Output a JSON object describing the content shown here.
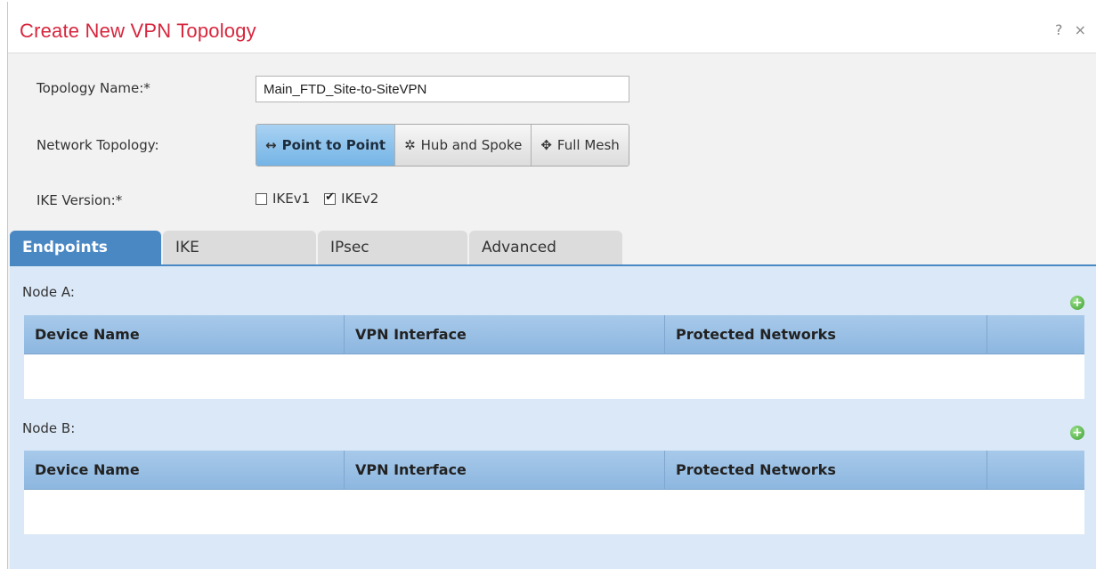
{
  "dialog": {
    "title": "Create New VPN Topology",
    "help": "?",
    "close": "×"
  },
  "form": {
    "topology_name_label": "Topology Name:*",
    "topology_name_value": "Main_FTD_Site-to-SiteVPN",
    "network_topology_label": "Network Topology:",
    "topology_options": [
      {
        "label": "Point to Point",
        "icon": "↔",
        "selected": true
      },
      {
        "label": "Hub and Spoke",
        "icon": "✲",
        "selected": false
      },
      {
        "label": "Full Mesh",
        "icon": "✥",
        "selected": false
      }
    ],
    "ike_version_label": "IKE Version:*",
    "ike_options": [
      {
        "label": "IKEv1",
        "checked": false
      },
      {
        "label": "IKEv2",
        "checked": true
      }
    ]
  },
  "tabs": [
    {
      "label": "Endpoints",
      "active": true
    },
    {
      "label": "IKE",
      "active": false
    },
    {
      "label": "IPsec",
      "active": false
    },
    {
      "label": "Advanced",
      "active": false
    }
  ],
  "nodes": [
    {
      "label": "Node A:",
      "columns": [
        "Device Name",
        "VPN Interface",
        "Protected Networks",
        ""
      ]
    },
    {
      "label": "Node B:",
      "columns": [
        "Device Name",
        "VPN Interface",
        "Protected Networks",
        ""
      ]
    }
  ],
  "colors": {
    "title": "#d7263d",
    "active_tab": "#4a88c4",
    "panel_bg": "#dbe8f7",
    "add_icon": "#3ea032"
  }
}
